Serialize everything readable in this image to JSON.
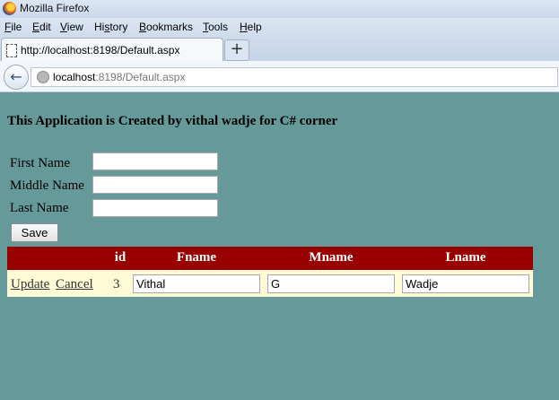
{
  "window": {
    "title": "Mozilla Firefox"
  },
  "menu": [
    {
      "accel": "F",
      "rest": "ile"
    },
    {
      "accel": "E",
      "rest": "dit"
    },
    {
      "accel": "V",
      "rest": "iew"
    },
    {
      "accel": "s",
      "pre": "Hi",
      "rest": "tory"
    },
    {
      "accel": "B",
      "rest": "ookmarks"
    },
    {
      "accel": "T",
      "rest": "ools"
    },
    {
      "accel": "H",
      "rest": "elp"
    }
  ],
  "tab": {
    "label": "http://localhost:8198/Default.aspx",
    "new_tab_label": "+"
  },
  "nav": {
    "url_host": "localhost",
    "url_rest": ":8198/Default.aspx"
  },
  "page": {
    "heading": "This Application is Created by vithal wadje for C# corner",
    "form": {
      "first_name_label": "First Name",
      "middle_name_label": "Middle Name",
      "last_name_label": "Last Name",
      "first_name_value": "",
      "middle_name_value": "",
      "last_name_value": "",
      "save_label": "Save"
    },
    "grid": {
      "headers": {
        "id": "id",
        "fname": "Fname",
        "mname": "Mname",
        "lname": "Lname"
      },
      "row": {
        "update_label": "Update",
        "cancel_label": "Cancel",
        "id": "3",
        "fname": "Vithal",
        "mname": "G",
        "lname": "Wadje"
      }
    }
  },
  "colors": {
    "page_bg": "#669999",
    "grid_header_bg": "#990000",
    "grid_row_bg": "#fffbd6"
  }
}
